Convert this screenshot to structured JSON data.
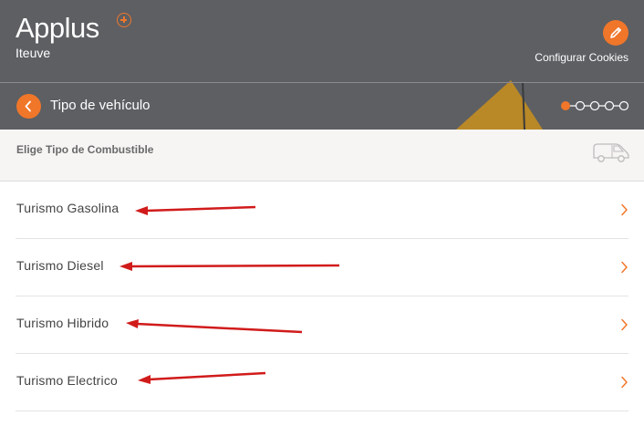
{
  "brand": {
    "logo_text": "Applus",
    "subbrand": "Iteuve"
  },
  "header": {
    "cookies_label": "Configurar Cookies",
    "cookies_icon": "pencil-icon"
  },
  "step": {
    "title": "Tipo de vehículo",
    "current": 1,
    "total": 5
  },
  "section": {
    "title": "Elige Tipo de Combustible",
    "icon": "van-icon"
  },
  "options": [
    {
      "label": "Turismo Gasolina"
    },
    {
      "label": "Turismo Diesel"
    },
    {
      "label": "Turismo Hibrido"
    },
    {
      "label": "Turismo Electrico"
    }
  ],
  "colors": {
    "accent": "#f0762a",
    "header_bg": "#5d5f63",
    "annotation_arrow": "#d11b1b"
  }
}
